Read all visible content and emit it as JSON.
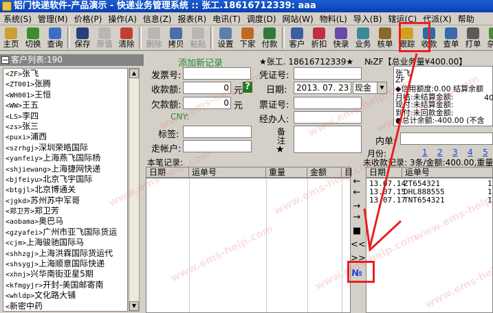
{
  "title": "铝门快递软件-产品演示 - 快递业务管理系统 :: 张工.18616712339: aaa",
  "menu": [
    "系统(S)",
    "管理(M)",
    "价格(P)",
    "操作(A)",
    "信息(Z)",
    "报表(R)",
    "电讯(T)",
    "调度(D)",
    "网站(W)",
    "物料(L)",
    "导入(B)",
    "辖运(C)",
    "代派(X)",
    "帮助"
  ],
  "toolbar": [
    {
      "label": "主页",
      "icon": "home-icon",
      "color": "#c9a035"
    },
    {
      "label": "切换",
      "icon": "switch-icon",
      "color": "#3d8c2e"
    },
    {
      "label": "查询",
      "icon": "search-icon",
      "color": "#3a6fc4"
    },
    {
      "label": "保存",
      "icon": "save-icon",
      "color": "#27407a"
    },
    {
      "label": "原值",
      "icon": "restore-icon",
      "color": "#9a9a9a",
      "disabled": true
    },
    {
      "label": "清除",
      "icon": "clear-icon",
      "color": "#c04030"
    },
    {
      "label": "删除",
      "icon": "delete-icon",
      "color": "#9a9a9a",
      "disabled": true
    },
    {
      "label": "拷贝",
      "icon": "copy-icon",
      "color": "#4a6fa8"
    },
    {
      "label": "粘贴",
      "icon": "paste-icon",
      "color": "#9a9a9a",
      "disabled": true
    },
    {
      "label": "设置",
      "icon": "settings-icon",
      "color": "#5a7fb0"
    },
    {
      "label": "下家",
      "icon": "next-icon",
      "color": "#c06a20"
    },
    {
      "label": "付款",
      "icon": "payment-icon",
      "color": "#2d7a3a"
    },
    {
      "label": "客户",
      "icon": "customer-icon",
      "color": "#3c5fa0"
    },
    {
      "label": "折扣",
      "icon": "discount-icon",
      "color": "#c03040"
    },
    {
      "label": "快录",
      "icon": "quick-entry-icon",
      "color": "#6a4aa8"
    },
    {
      "label": "业务",
      "icon": "business-icon",
      "color": "#3a8a9a"
    },
    {
      "label": "核单",
      "icon": "verify-icon",
      "color": "#8a6a2a"
    },
    {
      "label": "跟踪",
      "icon": "track-icon",
      "color": "#d0a020"
    },
    {
      "label": "收款",
      "icon": "receive-icon",
      "color": "#2a6aa8"
    },
    {
      "label": "查单",
      "icon": "query-order-icon",
      "color": "#3a6aa8"
    },
    {
      "label": "打单",
      "icon": "print-icon",
      "color": "#5a5a5a"
    },
    {
      "label": "杂收",
      "icon": "misc-icon",
      "color": "#4a8a3a"
    }
  ],
  "customers": {
    "header": "客户列表:190",
    "items": [
      {
        "code": "<ZF>",
        "name": "张飞"
      },
      {
        "code": "<ZT001>",
        "name": "张腾"
      },
      {
        "code": "<WH001>",
        "name": "王恒"
      },
      {
        "code": "<WW>",
        "name": "王五"
      },
      {
        "code": "<LS>",
        "name": "李四"
      },
      {
        "code": "<zs>",
        "name": "张三"
      },
      {
        "code": "<puxi>",
        "name": "浦西"
      },
      {
        "code": "<szrhgj>",
        "name": "深圳荣皓国际"
      },
      {
        "code": "<yanfeiy>",
        "name": "上海燕飞国际杨"
      },
      {
        "code": "<shjiewang>",
        "name": "上海捷网快递"
      },
      {
        "code": "<bjfeiyu>",
        "name": "北京飞宇国际"
      },
      {
        "code": "<btgjl>",
        "name": "北京博通关"
      },
      {
        "code": "<jgkd>",
        "name": "苏州苏中军哥"
      },
      {
        "code": "<郑卫芳>",
        "name": "郑卫芳"
      },
      {
        "code": "<aobama>",
        "name": "奥巴马"
      },
      {
        "code": "<gzyafei>",
        "name": "广州市亚飞国际货运"
      },
      {
        "code": "<cjm>",
        "name": "上海骏驰国际马"
      },
      {
        "code": "<shhzgj>",
        "name": "上海洪霖国际货运代"
      },
      {
        "code": "<shsygj>",
        "name": "上海顺意国际快递"
      },
      {
        "code": "<xhnj>",
        "name": "兴华南街亚星5期"
      },
      {
        "code": "<kfmgyjr>",
        "name": "开封-美国邮寄南"
      },
      {
        "code": "<whldp>",
        "name": "文化路大铺"
      },
      {
        "code": "<",
        "name": "新密中药"
      }
    ]
  },
  "form": {
    "add_record": "添加新记录",
    "invoice_label": "发票号:",
    "amount_label": "收款额:",
    "amount_value": "0",
    "amount_unit": "元",
    "owed_label": "欠款额:",
    "owed_value": "0",
    "owed_unit": "元",
    "currency": "CNY:",
    "tag_label": "标签:",
    "account_label": "走帐户:"
  },
  "voucher": {
    "user": "★张工. 18616712339★",
    "voucher_label": "凭证号:",
    "date_label": "日期:",
    "date_value": "2013. 07. 23",
    "method": "现金",
    "ticket_label": "票证号:",
    "handler_label": "经办人:",
    "note_label_1": "备",
    "note_label_2": "注",
    "star": "★"
  },
  "detail": {
    "header": "№ZF【总业务量¥400.00】",
    "lines": [
      "张飞",
      "ZF",
      "◆信用额度:0.00 结算余额",
      "月结:未结算金额:",
      "现付:未结算金额:",
      "到付:未回款金额:",
      "●总计余额:-400.00 (不含"
    ],
    "extra_num": "40",
    "inner_label": "内单:",
    "month_label": "月份:",
    "months": [
      "1",
      "2",
      "3",
      "4",
      "5"
    ]
  },
  "payments": {
    "title": "本笔记录:",
    "cols": [
      "日期",
      "运单号",
      "重量",
      "金额",
      "目"
    ]
  },
  "unpaid": {
    "title": "未收款记录: 3条/金额:400.00,重量",
    "cols": [
      "日期",
      "运单号"
    ],
    "rows": [
      {
        "date": "13.07.14",
        "no": "ZT654321",
        "flag": "1"
      },
      {
        "date": "13.07.15",
        "no": "DHL888555",
        "flag": "1"
      },
      {
        "date": "13.07.17",
        "no": "TNT654321",
        "flag": "1"
      }
    ]
  },
  "arrows": [
    "←",
    "←",
    "→",
    "→",
    "■",
    "<<",
    ">>",
    "№"
  ],
  "watermark": "www.ems-help.com"
}
